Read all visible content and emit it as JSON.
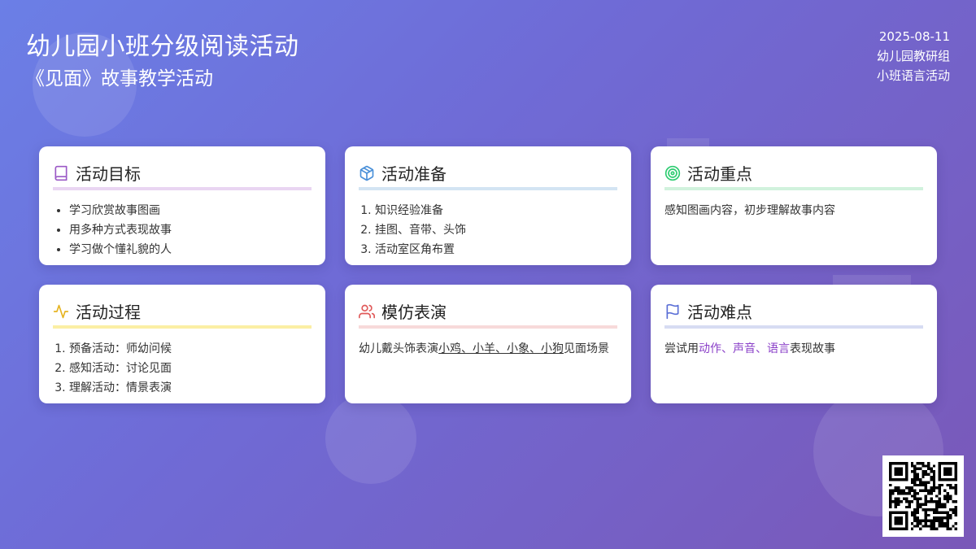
{
  "header": {
    "title": "幼儿园小班分级阅读活动",
    "subtitle": "《见面》故事教学活动"
  },
  "meta": {
    "date": "2025-08-11",
    "group": "幼儿园教研组",
    "category": "小班语言活动"
  },
  "cards": {
    "goals": {
      "title": "活动目标",
      "icon": "book-icon",
      "accent": "#e9d5f2",
      "items": [
        "学习欣赏故事图画",
        "用多种方式表现故事",
        "学习做个懂礼貌的人"
      ]
    },
    "prep": {
      "title": "活动准备",
      "icon": "box-icon",
      "accent": "#d3e4f3",
      "items": [
        "知识经验准备",
        "挂图、音带、头饰",
        "活动室区角布置"
      ]
    },
    "focus": {
      "title": "活动重点",
      "icon": "target-icon",
      "accent": "#d1f2dd",
      "text": "感知图画内容，初步理解故事内容"
    },
    "process": {
      "title": "活动过程",
      "icon": "activity-icon",
      "accent": "#fbefa4",
      "items": [
        "预备活动：师幼问候",
        "感知活动：讨论见面",
        "理解活动：情景表演"
      ]
    },
    "roleplay": {
      "title": "模仿表演",
      "icon": "users-icon",
      "accent": "#f7dada",
      "text_before": "幼儿戴头饰表演",
      "text_underlined": "小鸡、小羊、小象、小狗",
      "text_after": "见面场景"
    },
    "difficulty": {
      "title": "活动难点",
      "icon": "flag-icon",
      "accent": "#d7dcf3",
      "text_before": "尝试用",
      "word1": "动作",
      "sep1": "、",
      "word2": "声音",
      "sep2": "、",
      "word3": "语言",
      "text_after": "表现故事"
    }
  },
  "colors": {
    "accent_text": "#8a3fc8",
    "book_icon": "#9b59c6",
    "box_icon": "#4a90d9",
    "target_icon": "#2ecc71",
    "activity_icon": "#e6b422",
    "users_icon": "#e05a5a",
    "flag_icon": "#5b6fd6"
  },
  "qr": {
    "icon": "qr-code-icon"
  }
}
